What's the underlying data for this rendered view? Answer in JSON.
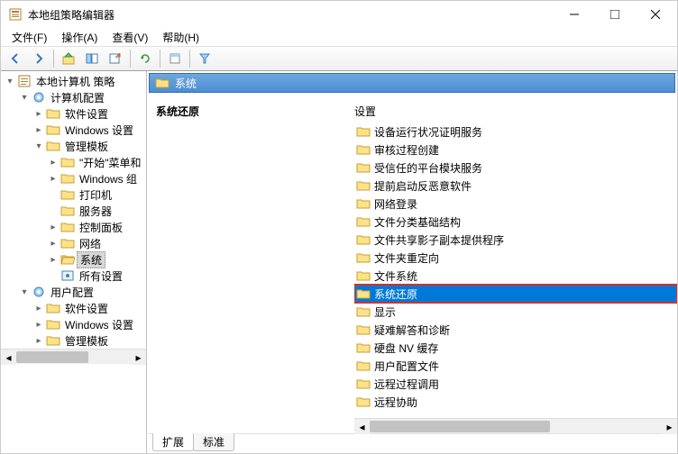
{
  "window": {
    "title": "本地组策略编辑器"
  },
  "menu": {
    "file": "文件(F)",
    "action": "操作(A)",
    "view": "查看(V)",
    "help": "帮助(H)"
  },
  "tree": {
    "root": "本地计算机 策略",
    "computer": "计算机配置",
    "c_soft": "软件设置",
    "c_win": "Windows 设置",
    "c_tmpl": "管理模板",
    "t_start": "\"开始\"菜单和",
    "t_wincomp": "Windows 组",
    "t_printer": "打印机",
    "t_server": "服务器",
    "t_cp": "控制面板",
    "t_net": "网络",
    "t_sys": "系统",
    "t_all": "所有设置",
    "user": "用户配置",
    "u_soft": "软件设置",
    "u_win": "Windows 设置",
    "u_tmpl": "管理模板"
  },
  "content": {
    "header": "系统",
    "desc_title": "系统还原",
    "list_header": "设置",
    "items": [
      "设备运行状况证明服务",
      "审核过程创建",
      "受信任的平台模块服务",
      "提前启动反恶意软件",
      "网络登录",
      "文件分类基础结构",
      "文件共享影子副本提供程序",
      "文件夹重定向",
      "文件系统",
      "系统还原",
      "显示",
      "疑难解答和诊断",
      "硬盘 NV 缓存",
      "用户配置文件",
      "远程过程调用",
      "远程协助"
    ],
    "selected_index": 9
  },
  "tabs": {
    "ext": "扩展",
    "std": "标准"
  }
}
